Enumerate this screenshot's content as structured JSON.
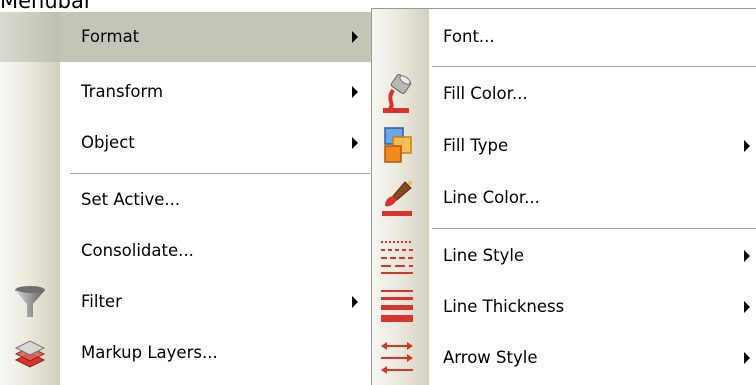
{
  "page": {
    "title": "Menubar"
  },
  "menu": {
    "items": [
      {
        "label": "Format",
        "has_submenu": true,
        "highlighted": true
      },
      {
        "label": "Transform",
        "has_submenu": true
      },
      {
        "label": "Object",
        "has_submenu": true
      },
      {
        "label": "Set Active..."
      },
      {
        "label": "Consolidate..."
      },
      {
        "label": "Filter",
        "has_submenu": true,
        "icon": "funnel-icon"
      },
      {
        "label": "Markup Layers...",
        "icon": "layers-icon"
      }
    ]
  },
  "submenu": {
    "items": [
      {
        "label": "Font..."
      },
      {
        "label": "Fill Color...",
        "icon": "paint-bucket-icon"
      },
      {
        "label": "Fill Type",
        "has_submenu": true,
        "icon": "fill-type-icon"
      },
      {
        "label": "Line Color...",
        "icon": "paintbrush-icon"
      },
      {
        "label": "Line Style",
        "has_submenu": true,
        "icon": "line-style-icon"
      },
      {
        "label": "Line Thickness",
        "has_submenu": true,
        "icon": "line-thickness-icon"
      },
      {
        "label": "Arrow Style",
        "has_submenu": true,
        "icon": "arrow-style-icon"
      }
    ]
  },
  "colors": {
    "highlight": "#c2c5b8",
    "gutter": "#e6e4d6",
    "accent_red": "#d9342b"
  }
}
